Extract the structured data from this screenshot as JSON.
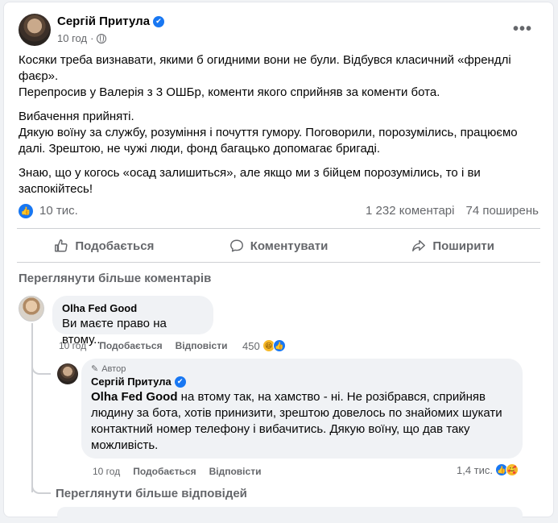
{
  "post": {
    "author": "Сергій Притула",
    "time": "10 год",
    "paragraphs": [
      "Косяки треба визнавати, якими б огидними вони не були. Відбувся класичний «френдлі фаєр».\nПерепросив у Валерія з 3 ОШБр, коменти якого сприйняв за коменти бота.",
      "Вибачення прийняті.\nДякую воїну за службу, розуміння і почуття гумору. Поговорили, порозумілись, працюємо далі. Зрештою, не чужі люди, фонд багацько допомагає бригаді.",
      "Знаю, що у когось «осад залишиться», але якщо ми з бійцем порозумілись, то і ви заспокійтесь!"
    ],
    "reactions_count": "10 тис.",
    "comments_count": "1 232 коментарі",
    "shares_count": "74 поширень"
  },
  "actions": {
    "like": "Подобається",
    "comment": "Коментувати",
    "share": "Поширити"
  },
  "view_more_comments": "Переглянути більше коментарів",
  "comments": [
    {
      "author": "Olha Fed Good",
      "text": "Ви маєте право на втому...",
      "time": "10 год",
      "like_label": "Подобається",
      "reply_label": "Відповісти",
      "reactions": "450"
    },
    {
      "author_tag": "Автор",
      "author": "Сергій Притула",
      "mention": "Olha Fed Good",
      "text": " на втому так, на хамство - ні. Не розібрався, сприйняв людину за бота, хотів принизити, зрештою довелось по знайомих шукати контактний номер телефону і вибачитись. Дякую воїну, що дав таку можливість.",
      "time": "10 год",
      "like_label": "Подобається",
      "reply_label": "Відповісти",
      "reactions": "1,4 тис."
    }
  ],
  "view_more_replies": "Переглянути більше відповідей",
  "colors": {
    "accent": "#1877f2",
    "secondary_text": "#65676b",
    "bubble_bg": "#f0f2f5"
  },
  "icons": [
    "verified-badge-icon",
    "globe-icon",
    "more-options-icon",
    "like-reaction-icon",
    "like-outline-icon",
    "comment-bubble-icon",
    "share-arrow-icon",
    "haha-reaction-icon",
    "care-reaction-icon",
    "pencil-icon"
  ]
}
